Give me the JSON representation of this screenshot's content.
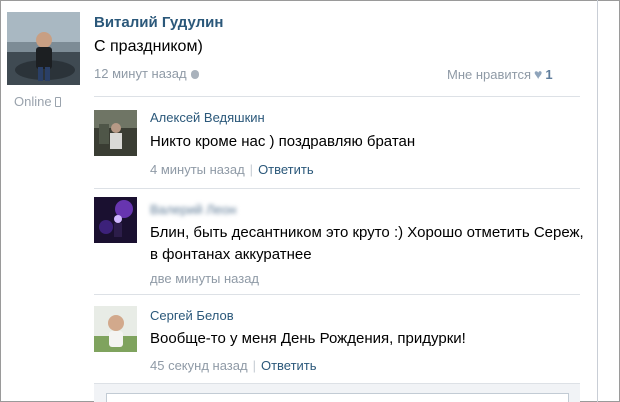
{
  "post": {
    "author": "Виталий Гудулин",
    "text": "С праздником)",
    "time": "12 минут назад",
    "like_label": "Мне нравится",
    "like_count": "1",
    "online": "Online"
  },
  "comments": [
    {
      "author": "Алексей Ведяшкин",
      "text": "Никто кроме нас ) поздравляю братан",
      "time": "4 минуты назад",
      "reply": "Ответить"
    },
    {
      "author": "Валерий Леон",
      "text": "Блин, быть десантником это круто :) Хорошо отметить Сереж, в фонтанах аккуратнее",
      "time": "две минуты назад"
    },
    {
      "author": "Сергей Белов",
      "text": "Вообще-то у меня День Рождения, придурки!",
      "time": "45 секунд назад",
      "reply": "Ответить"
    }
  ],
  "icons": {
    "phone": "mobile-phone-icon",
    "apple": "apple-icon",
    "heart": "heart-icon"
  },
  "colors": {
    "author_link": "#2b587a",
    "meta_gray": "#8f9aa6",
    "divider": "#dde1e6"
  }
}
